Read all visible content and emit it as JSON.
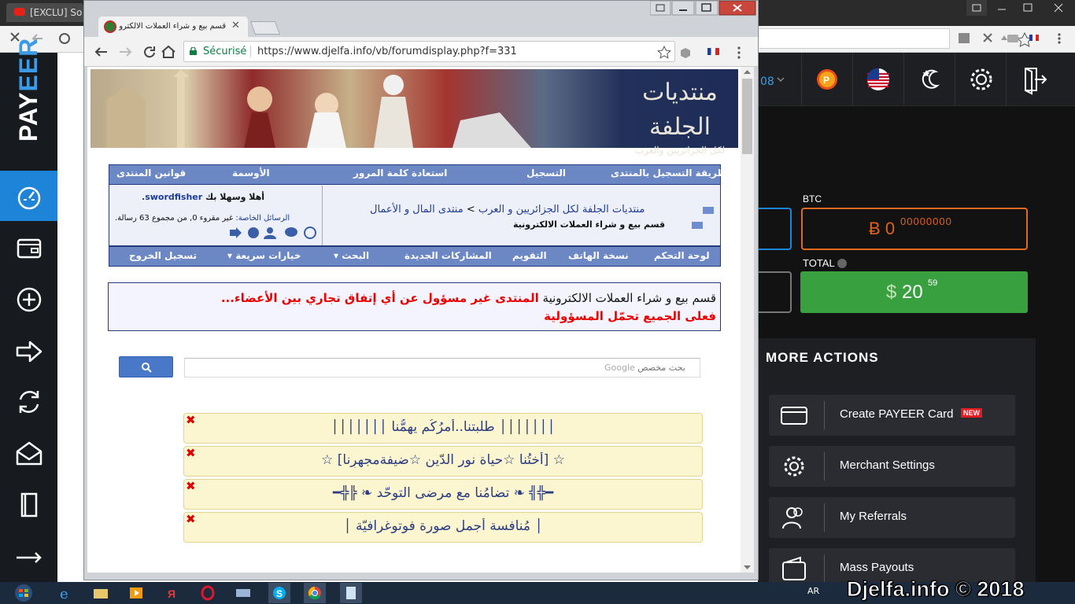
{
  "background_browser": {
    "tab_title": "[EXCLU] So"
  },
  "payeer": {
    "logo_left": "PAY",
    "logo_right": "EER",
    "topbar_partial": "08",
    "btc": {
      "label": "BTC",
      "currency_symbol": "Ƀ",
      "integer": "0",
      "fraction": "00000000"
    },
    "total": {
      "label": "TOTAL",
      "currency_symbol": "$",
      "integer": "20",
      "fraction": "59"
    },
    "more_actions": {
      "title": "MORE ACTIONS",
      "items": [
        {
          "label": "Create PAYEER Card",
          "icon": "card-icon",
          "badge": "NEW"
        },
        {
          "label": "Merchant Settings",
          "icon": "gear-icon"
        },
        {
          "label": "My Referrals",
          "icon": "referrals-icon"
        },
        {
          "label": "Mass Payouts",
          "icon": "wallet-icon"
        }
      ]
    },
    "colors": {
      "accent_blue": "#1e84d8",
      "btc_orange": "#e06a1f",
      "total_green": "#38a03e"
    }
  },
  "front_browser": {
    "tab_title": "قسم بيع و شراء العملات الالكترو",
    "secure_label": "Sécurisé",
    "url": "https://www.djelfa.info/vb/forumdisplay.php?f=331"
  },
  "forum": {
    "banner_title": "منتديات الجلفة",
    "banner_subtitle": "لكل الجزائريين والعرب",
    "top_nav": [
      "طريقة التسجيل بالمنتدى",
      "التسجيل",
      "استعادة كلمة المرور",
      "الأوسمة",
      "قوانين المنتدى"
    ],
    "welcome_prefix": "أهلا وسهلا بك ",
    "username": "swordfisher.",
    "pm_label": "الرسائل الخاصة:",
    "pm_text": " غير مقروء 0, من مجموع 63 رسالة.",
    "breadcrumb_root": "منتديات الجلفة لكل الجزائريين و العرب",
    "breadcrumb_sep": ">",
    "breadcrumb_parent": "منتدى المال و الأعمال",
    "breadcrumb_current": "قسم بيع و شراء العملات الالكترونية",
    "bottom_nav": [
      "لوحة التحكم",
      "نسخة الهاتف",
      "التقويم",
      "المشاركات الجديدة",
      "البحث",
      "خيارات سريعة",
      "تسجيل الخروج"
    ],
    "notice_section": "قسم بيع و شراء العملات الالكترونية ",
    "notice_red": "المنتدى غير مسؤول عن أي إتفاق تجاري بين الأعضاء...",
    "notice_line2": "فعلى الجميع تحمّل المسؤولية",
    "search_placeholder": "بحث مخصص",
    "search_brand": "Google",
    "announcements": [
      "│││││││ طلبتنا..أمرُكُم يهمُّنا │││││││",
      "☆ [أختُنا ☆حياة نور الدّين ☆ضيفةمجهرِنا] ☆",
      "━╬╣ ❧ تضامُنا مع مرضى التوحّد ❧ ╠╬━",
      "│ مُنافسة أجمل صورة فوتوغرافيّة │"
    ]
  },
  "taskbar": {
    "lang": "AR",
    "watermark": "Djelfa.info © 2018"
  }
}
